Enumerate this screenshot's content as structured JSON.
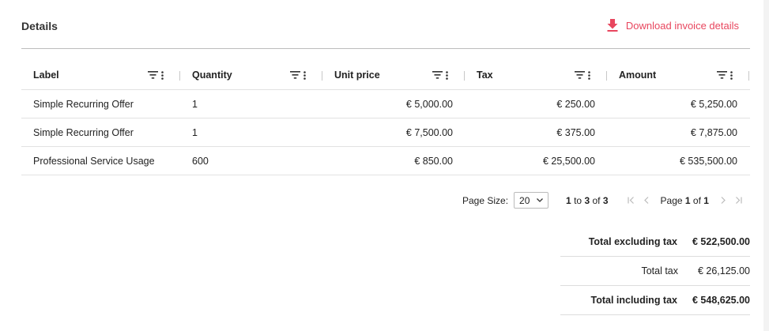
{
  "section": {
    "title": "Details",
    "download_label": "Download invoice details"
  },
  "colors": {
    "accent": "#e8465e"
  },
  "table": {
    "columns": [
      "Label",
      "Quantity",
      "Unit price",
      "Tax",
      "Amount"
    ],
    "rows": [
      [
        "Simple Recurring Offer",
        "1",
        "€ 5,000.00",
        "€ 250.00",
        "€ 5,250.00"
      ],
      [
        "Simple Recurring Offer",
        "1",
        "€ 7,500.00",
        "€ 375.00",
        "€ 7,875.00"
      ],
      [
        "Professional Service Usage",
        "600",
        "€ 850.00",
        "€ 25,500.00",
        "€ 535,500.00"
      ]
    ]
  },
  "pager": {
    "page_size_label": "Page Size:",
    "page_size_value": "20",
    "range_from": "1",
    "range_to": "3",
    "range_total": "3",
    "range_word_to": "to",
    "range_word_of": "of",
    "page_word": "Page",
    "page_current": "1",
    "page_total": "1"
  },
  "totals": [
    {
      "label": "Total excluding tax",
      "value": "€ 522,500.00",
      "bold": true
    },
    {
      "label": "Total tax",
      "value": "€ 26,125.00",
      "bold": false
    },
    {
      "label": "Total including tax",
      "value": "€ 548,625.00",
      "bold": true
    }
  ]
}
